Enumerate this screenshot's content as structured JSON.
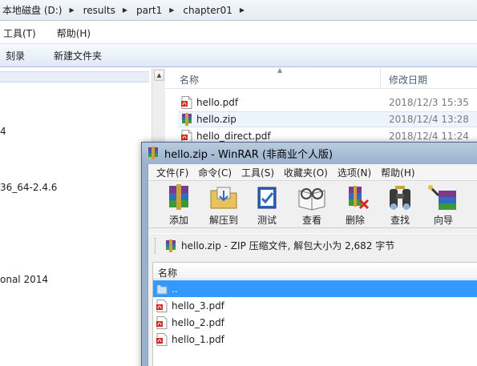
{
  "explorer": {
    "breadcrumb": [
      "本地磁盘 (D:)",
      "results",
      "part1",
      "chapter01"
    ],
    "menu": [
      "工具(T)",
      "帮助(H)"
    ],
    "toolbar": [
      "刻录",
      "新建文件夹"
    ],
    "tree": [
      "4",
      "36_64-2.4.6",
      "onal 2014"
    ],
    "columns": {
      "name": "名称",
      "modified": "修改日期"
    },
    "files": [
      {
        "name": "hello.pdf",
        "date": "2018/12/3 15:35",
        "type": "pdf"
      },
      {
        "name": "hello.zip",
        "date": "2018/12/4 13:28",
        "type": "rar"
      },
      {
        "name": "hello_direct.pdf",
        "date": "2018/12/4 11:24",
        "type": "pdf"
      }
    ]
  },
  "winrar": {
    "title": "hello.zip - WinRAR (非商业个人版)",
    "menu": [
      "文件(F)",
      "命令(C)",
      "工具(S)",
      "收藏夹(O)",
      "选项(N)",
      "帮助(H)"
    ],
    "tools": [
      {
        "label": "添加",
        "icon": "add-icon"
      },
      {
        "label": "解压到",
        "icon": "extract-to-icon"
      },
      {
        "label": "测试",
        "icon": "test-icon"
      },
      {
        "label": "查看",
        "icon": "view-icon"
      },
      {
        "label": "删除",
        "icon": "delete-icon"
      },
      {
        "label": "查找",
        "icon": "find-icon"
      },
      {
        "label": "向导",
        "icon": "wizard-icon"
      }
    ],
    "path_text": "hello.zip - ZIP 压缩文件, 解包大小为 2,682 字节",
    "list_header": "名称",
    "items": [
      {
        "name": "..",
        "type": "folder-up"
      },
      {
        "name": "hello_3.pdf",
        "type": "pdf"
      },
      {
        "name": "hello_2.pdf",
        "type": "pdf"
      },
      {
        "name": "hello_1.pdf",
        "type": "pdf"
      }
    ]
  },
  "colors": {
    "selection": "#3399ff",
    "explorer_bar": "#dfe9f5",
    "winrar_frame": "#9bb2cc"
  }
}
